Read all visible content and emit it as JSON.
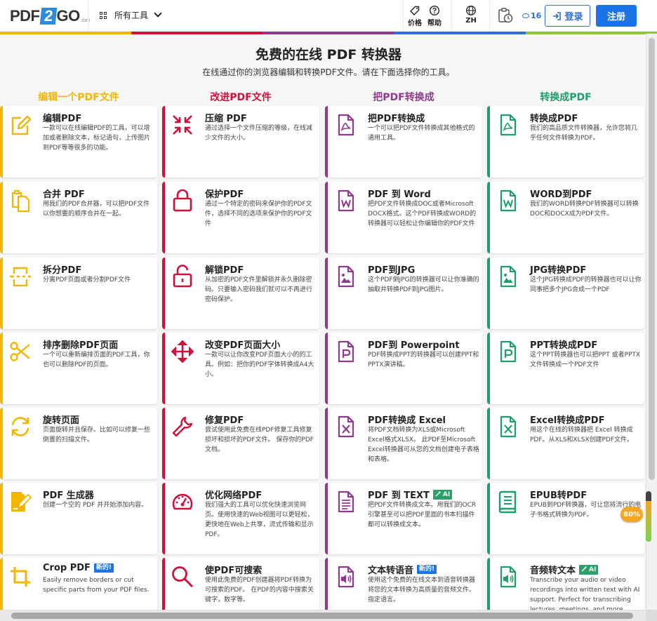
{
  "header": {
    "logo_left": "PDF",
    "logo_mid": "2",
    "logo_right": "GO",
    "logo_suffix": ".com",
    "tools_label": "所有工具",
    "price_label": "价格",
    "help_label": "帮助",
    "lang_label": "ZH",
    "credits": "16",
    "login_label": "登录",
    "register_label": "注册"
  },
  "colors": {
    "yellow": "#f2b600",
    "red": "#d0103a",
    "purple": "#8e3a8c",
    "green": "#1e9e6a",
    "blue": "#1a73e8"
  },
  "hero": {
    "title": "免费的在线 PDF 转换器",
    "subtitle": "在线通过你的浏览器编辑和转换PDF文件。请在下面选择你的工具。"
  },
  "columns": [
    {
      "title": "编辑一个PDF文件",
      "color": "#f2b600"
    },
    {
      "title": "改进PDF文件",
      "color": "#d0103a"
    },
    {
      "title": "把PDF转换成",
      "color": "#8e3a8c"
    },
    {
      "title": "转换成PDF",
      "color": "#1e9e6a"
    }
  ],
  "cards": [
    [
      {
        "title": "编辑PDF",
        "desc": "一款可以在线编辑PDF的工具，可以增加或者删除文本，标记语句，上传图片到PDF等等很多的功能。",
        "icon": "edit-icon"
      },
      {
        "title": "合并 PDF",
        "desc": "用我们的PDF合并器，可以把PDF文件以你想要的顺序合并在一起。",
        "icon": "merge-icon"
      },
      {
        "title": "拆分PDF",
        "desc": "分离PDF页面或者分割PDF文件",
        "icon": "split-icon"
      },
      {
        "title": "排序删除PDF页面",
        "desc": "一个可以重新编排页面的PDF工具，你也可以删除PDF的页面。",
        "icon": "scissors-icon"
      },
      {
        "title": "旋转页面",
        "desc": "页面旋转并且保存。比如可以修复一些倒置的扫描文件。",
        "icon": "rotate-icon"
      },
      {
        "title": "PDF 生成器",
        "desc": "创建一个空的 PDF 并开始添加内容。",
        "icon": "create-icon"
      },
      {
        "title": "Crop PDF",
        "badge": "新的!",
        "desc": "Easily remove borders or cut specific parts from your PDF files.",
        "icon": "crop-icon"
      }
    ],
    [
      {
        "title": "压缩 PDF",
        "desc": "通过选择一个文件压缩的等级，在线减少文件的大小。",
        "icon": "compress-icon"
      },
      {
        "title": "保护PDF",
        "desc": "通过一个特定的密码来保护你的PDF文件，选择不同的选项来保护你的PDF文件",
        "icon": "lock-icon"
      },
      {
        "title": "解锁PDF",
        "desc": "从加密的PDF文件里解锁并永久删除密码。只要输入密码我们就可以不再进行密码保护。",
        "icon": "unlock-icon"
      },
      {
        "title": "改变PDF页面大小",
        "desc": "一款可以让你改变PDF页面大小的的工具。例如：把你的PDF字体转换成A4大小。",
        "icon": "resize-icon"
      },
      {
        "title": "修复PDF",
        "desc": "尝试使用此免费在线PDF修复工具修复损坏和损坏的PDF文件。 保存你的PDF文档。",
        "icon": "wrench-icon"
      },
      {
        "title": "优化网络PDF",
        "desc": "我们强大的工具可以优化快速浏览网页。使用快速的Web视图可以更轻松，更快地在Web上共享，流式传输和显示PDF。",
        "icon": "gauge-icon"
      },
      {
        "title": "使PDF可搜索",
        "desc": "使用此免费的PDF创建器将PDF转换为可搜索的PDF。 在PDF的内容中搜索关键字，数字等。",
        "icon": "search-icon"
      }
    ],
    [
      {
        "title": "把PDF转换成",
        "desc": "一个可以把PDF文件转换成其他格式的通用工具。",
        "icon": "pdf-file-icon"
      },
      {
        "title": "PDF 到 Word",
        "desc": "把PDF文件转换成DOC或者Microsoft DOCX格式。这个PDF转换成WORD的转换器可以轻松让你编辑你的PDF文件",
        "icon": "word-file-icon"
      },
      {
        "title": "PDF到JPG",
        "desc": "这个PDF倒JPG的转换器可以让你准确的抽取并转换PDF到JPG图片。",
        "icon": "image-file-icon"
      },
      {
        "title": "PDF到 Powerpoint",
        "desc": "PDF转换成PPT的转换器可以创建PPT和PPTX演讲稿。",
        "icon": "ppt-file-icon"
      },
      {
        "title": "PDF转换成 Excel",
        "desc": "将PDF文档转换为XLS或Microsoft Excel格式XLSX。 此PDF至Microsoft Excel转换器可从您的文档创建电子表格和表格。",
        "icon": "excel-file-icon"
      },
      {
        "title": "PDF 到 TEXT",
        "badge_ai": "AI",
        "desc": "把PDF文件转换成文本。用我们的OCR引擎甚至可以把PDF里面的书本扫描件都可以转换成文本。",
        "icon": "text-file-icon"
      },
      {
        "title": "文本转语音",
        "badge": "新的!",
        "desc": "使用这个免费的在线文本到语音转换器将您的文本转换为高质量的音频文件。指定语言。",
        "icon": "audio-file-icon"
      }
    ],
    [
      {
        "title": "转换成PDF",
        "desc": "我们的高品质文件转换器，允许您将几乎任何文件转换为PDF。",
        "icon": "pdf-file-icon"
      },
      {
        "title": "WORD到PDF",
        "desc": "我们的WORD转换PDF转换器可以转换DOC和DOCX成为PDF文件。",
        "icon": "word-file-icon"
      },
      {
        "title": "JPG转换PDF",
        "desc": "这个JPG转换成PDF的转换器也可以让你同事把多个JPG合成一个PDF",
        "icon": "image-file-icon"
      },
      {
        "title": "PPT转换成PDF",
        "desc": "这个PPT转换器也可以把PPT 或者PPTX文件转换成一个PDF文件",
        "icon": "ppt-file-icon"
      },
      {
        "title": "Excel转换成PDF",
        "desc": "用这个在线的转换器把 Excel 转换成PDF。从XLS和XLSX创建PDF文件。",
        "icon": "excel-file-icon"
      },
      {
        "title": "EPUB转PDF",
        "desc": "EPUB到PDF转换器，可让您将流行的电子书格式转换为PDF。",
        "icon": "book-icon"
      },
      {
        "title": "音频转文本",
        "badge_ai": "AI",
        "desc": "Transcribe your audio or video recordings into written text with AI support. Perfect for transcribing lectures, meetings, and more.",
        "icon": "audio-file-icon"
      }
    ]
  ],
  "progress": {
    "label": "80%",
    "value": 0.8
  }
}
